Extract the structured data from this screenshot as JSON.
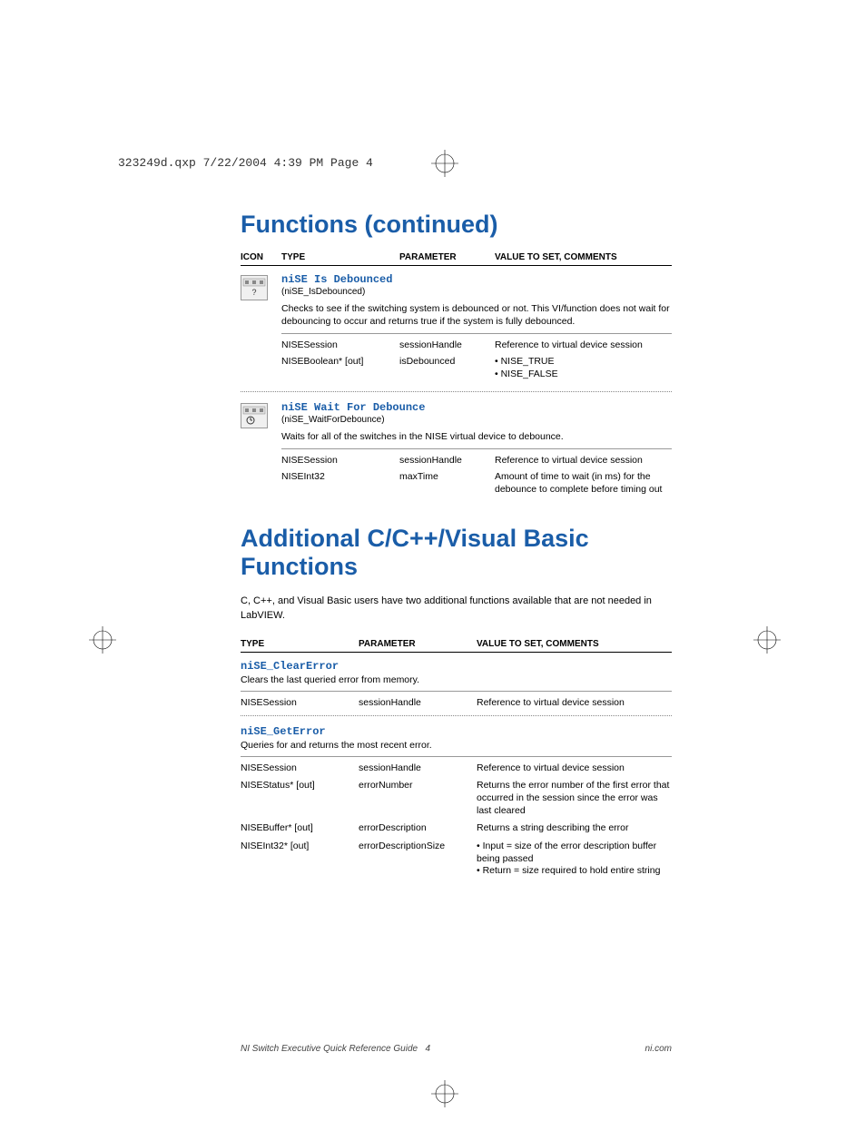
{
  "header_slug": "323249d.qxp  7/22/2004  4:39 PM  Page 4",
  "section1_title": "Functions (continued)",
  "table1_headers": {
    "icon": "ICON",
    "type": "TYPE",
    "param": "PARAMETER",
    "value": "VALUE TO SET, COMMENTS"
  },
  "func1": {
    "name": "niSE Is Debounced",
    "cname": "(niSE_IsDebounced)",
    "desc": "Checks to see if the switching system is debounced or not. This VI/function does not wait for debouncing to occur and returns true if the system is fully debounced.",
    "rows": [
      {
        "type": "NISESession",
        "param": "sessionHandle",
        "value": "Reference to virtual device session"
      },
      {
        "type": "NISEBoolean* [out]",
        "param": "isDebounced",
        "value": "• NISE_TRUE\n• NISE_FALSE"
      }
    ]
  },
  "func2": {
    "name": "niSE Wait For Debounce",
    "cname": "(niSE_WaitForDebounce)",
    "desc": "Waits for all of the switches in the NISE virtual device to debounce.",
    "rows": [
      {
        "type": "NISESession",
        "param": "sessionHandle",
        "value": "Reference to virtual device session"
      },
      {
        "type": "NISEInt32",
        "param": "maxTime",
        "value": "Amount of time to wait (in ms) for the debounce to complete before timing out"
      }
    ]
  },
  "section2_title": "Additional C/C++/Visual Basic Functions",
  "section2_intro": "C, C++, and Visual Basic users have two additional functions available that are not needed in LabVIEW.",
  "table2_headers": {
    "type": "TYPE",
    "param": "PARAMETER",
    "value": "VALUE TO SET, COMMENTS"
  },
  "func3": {
    "name": "niSE_ClearError",
    "desc": "Clears the last queried error from memory.",
    "rows": [
      {
        "type": "NISESession",
        "param": "sessionHandle",
        "value": "Reference to virtual device session"
      }
    ]
  },
  "func4": {
    "name": "niSE_GetError",
    "desc": "Queries for and returns the most recent error.",
    "rows": [
      {
        "type": "NISESession",
        "param": "sessionHandle",
        "value": "Reference to virtual device session"
      },
      {
        "type": "NISEStatus* [out]",
        "param": "errorNumber",
        "value": "Returns the error number of the first error that occurred in the session since the error was last cleared"
      },
      {
        "type": "NISEBuffer* [out]",
        "param": "errorDescription",
        "value": "Returns a string describing the error"
      },
      {
        "type": "NISEInt32* [out]",
        "param": "errorDescriptionSize",
        "value": "• Input = size of the error description buffer being passed\n• Return = size required to hold entire string"
      }
    ]
  },
  "footer": {
    "left": "NI Switch Executive Quick Reference Guide",
    "page": "4",
    "right": "ni.com"
  }
}
